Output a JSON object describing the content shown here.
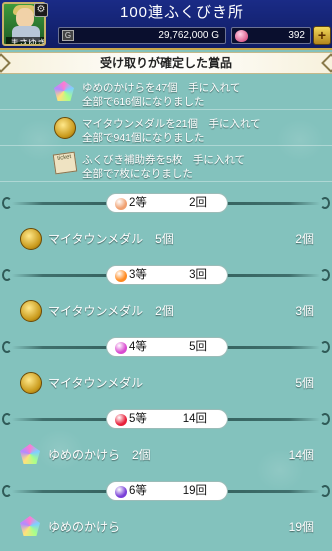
{
  "header": {
    "title": "100連ふくびき所",
    "player_name": "まさゆき",
    "gold": "29,762,000 G",
    "gems": "392",
    "plus_label": "+"
  },
  "section_title": "受け取りが確定した賞品",
  "confirmed_items": [
    {
      "icon": "crystal-icon",
      "line1": "ゆめのかけらを47個　手に入れて",
      "line2": "全部で616個になりました"
    },
    {
      "icon": "medal-icon",
      "line1": "マイタウンメダルを21個　手に入れて",
      "line2": "全部で941個になりました"
    },
    {
      "icon": "ticket-icon",
      "line1": "ふくびき補助券を5枚　手に入れて",
      "line2": "全部で7枚になりました"
    }
  ],
  "ranks": [
    {
      "label": "2等",
      "count": "2回",
      "orb_color": "#f0a070",
      "prize": {
        "icon": "medal-icon",
        "name": "マイタウンメダル　5個",
        "total": "2個"
      }
    },
    {
      "label": "3等",
      "count": "3回",
      "orb_color": "#ff8a20",
      "prize": {
        "icon": "medal-icon",
        "name": "マイタウンメダル　2個",
        "total": "3個"
      }
    },
    {
      "label": "4等",
      "count": "5回",
      "orb_color": "#d94ad0",
      "prize": {
        "icon": "medal-icon",
        "name": "マイタウンメダル",
        "total": "5個"
      }
    },
    {
      "label": "5等",
      "count": "14回",
      "orb_color": "#e8203a",
      "prize": {
        "icon": "crystal-icon",
        "name": "ゆめのかけら　2個",
        "total": "14個"
      }
    },
    {
      "label": "6等",
      "count": "19回",
      "orb_color": "#7a40d8",
      "prize": {
        "icon": "crystal-icon",
        "name": "ゆめのかけら",
        "total": "19個"
      }
    }
  ]
}
